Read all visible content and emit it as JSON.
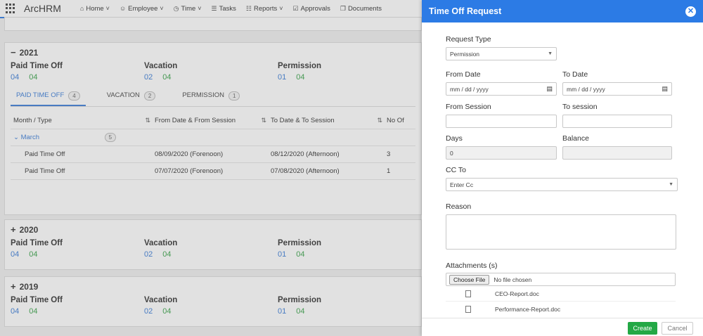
{
  "app": {
    "brand": "ArcHRM"
  },
  "nav": [
    {
      "icon": "home-icon",
      "glyph": "⌂",
      "label": "Home",
      "dropdown": true
    },
    {
      "icon": "person-icon",
      "glyph": "☺",
      "label": "Employee",
      "dropdown": true
    },
    {
      "icon": "clock-icon",
      "glyph": "◷",
      "label": "Time",
      "dropdown": true
    },
    {
      "icon": "tasks-icon",
      "glyph": "☰",
      "label": "Tasks",
      "dropdown": false
    },
    {
      "icon": "bar-chart-icon",
      "glyph": "☷",
      "label": "Reports",
      "dropdown": true
    },
    {
      "icon": "check-square-icon",
      "glyph": "☑",
      "label": "Approvals",
      "dropdown": false
    },
    {
      "icon": "document-icon",
      "glyph": "❐",
      "label": "Documents",
      "dropdown": false
    }
  ],
  "years": [
    {
      "year": "2021",
      "sign": "−"
    },
    {
      "year": "2020",
      "sign": "+"
    },
    {
      "year": "2019",
      "sign": "+"
    }
  ],
  "summary": [
    {
      "label": "Paid Time Off",
      "a": "04",
      "b": "04"
    },
    {
      "label": "Vacation",
      "a": "02",
      "b": "04"
    },
    {
      "label": "Permission",
      "a": "01",
      "b": "04"
    }
  ],
  "tabs": [
    {
      "label": "PAID TIME OFF",
      "count": "4"
    },
    {
      "label": "VACATION",
      "count": "2"
    },
    {
      "label": "PERMISSION",
      "count": "1"
    }
  ],
  "table": {
    "headers": [
      "Month / Type",
      "From Date & From Session",
      "To Date & To Session",
      "No Of"
    ],
    "group": {
      "label": "March",
      "count": "5"
    },
    "rows": [
      [
        "Paid Time Off",
        "08/09/2020 (Forenoon)",
        "08/12/2020 (Afternoon)",
        "3"
      ],
      [
        "Paid Time Off",
        "07/07/2020 (Forenoon)",
        "07/08/2020 (Afternoon)",
        "1"
      ]
    ]
  },
  "panel": {
    "title": "Time Off Request",
    "request_type_label": "Request Type",
    "request_type_value": "Permission",
    "from_date_label": "From Date",
    "to_date_label": "To Date",
    "date_placeholder": "mm / dd / yyyy",
    "from_session_label": "From Session",
    "to_session_label": "To session",
    "days_label": "Days",
    "days_value": "0",
    "balance_label": "Balance",
    "cc_label": "CC To",
    "cc_value": "Enter Cc",
    "reason_label": "Reason",
    "attachments_label": "Attachments (s)",
    "choose_file_label": "Choose File",
    "no_file_text": "No file chosen",
    "files": [
      "CEO-Report.doc",
      "Performance-Report.doc"
    ],
    "create_label": "Create",
    "cancel_label": "Cancel"
  },
  "colors": {
    "accent": "#2c7be5",
    "create": "#23a845",
    "value_blue": "#3b7dd8",
    "value_green": "#3aa34a"
  }
}
